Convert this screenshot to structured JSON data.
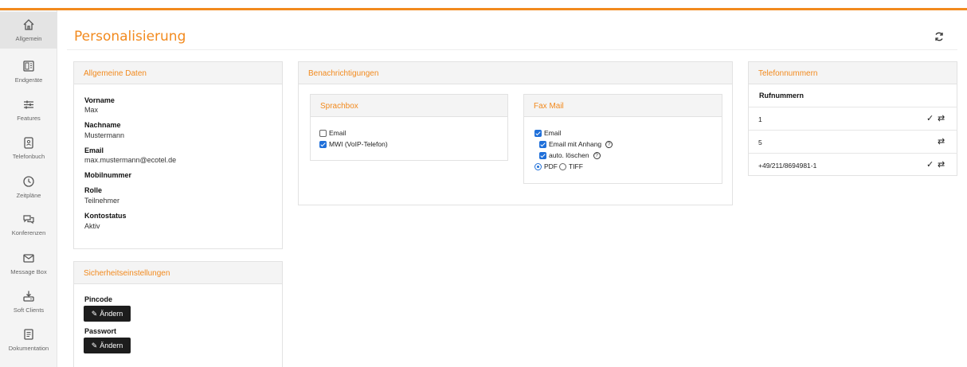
{
  "sidebar": {
    "items": [
      {
        "label": "Allgemein",
        "icon": "home-icon",
        "active": true
      },
      {
        "label": "Endgeräte",
        "icon": "device-icon"
      },
      {
        "label": "Features",
        "icon": "sliders-icon"
      },
      {
        "label": "Telefonbuch",
        "icon": "phonebook-icon"
      },
      {
        "label": "Zeitpläne",
        "icon": "clock-icon"
      },
      {
        "label": "Konferenzen",
        "icon": "chat-icon"
      },
      {
        "label": "Message Box",
        "icon": "mail-icon"
      },
      {
        "label": "Soft Clients",
        "icon": "download-icon"
      },
      {
        "label": "Dokumentation",
        "icon": "document-icon"
      }
    ]
  },
  "page": {
    "title": "Personalisierung",
    "accent_color": "#f28a1e"
  },
  "general": {
    "title": "Allgemeine Daten",
    "fields": [
      {
        "label": "Vorname",
        "value": "Max"
      },
      {
        "label": "Nachname",
        "value": "Mustermann"
      },
      {
        "label": "Email",
        "value": "max.mustermann@ecotel.de"
      },
      {
        "label": "Mobilnummer",
        "value": ""
      },
      {
        "label": "Rolle",
        "value": "Teilnehmer"
      },
      {
        "label": "Kontostatus",
        "value": "Aktiv"
      }
    ]
  },
  "security": {
    "title": "Sicherheitseinstellungen",
    "pin_label": "Pincode",
    "password_label": "Passwort",
    "change_label": "Ändern"
  },
  "notifications": {
    "title": "Benachrichtigungen",
    "voicebox": {
      "title": "Sprachbox",
      "email_label": "Email",
      "email_checked": false,
      "mwi_label": "MWI (VoIP-Telefon)",
      "mwi_checked": true
    },
    "fax": {
      "title": "Fax Mail",
      "email_label": "Email",
      "email_checked": true,
      "attachment_label": "Email mit Anhang",
      "attachment_checked": true,
      "delete_label": "auto. löschen",
      "delete_checked": true,
      "format_options": [
        "PDF",
        "TIFF"
      ],
      "format_selected": "PDF"
    }
  },
  "phones": {
    "title": "Telefonnummern",
    "header": "Rufnummern",
    "rows": [
      {
        "number": "1",
        "checked": true
      },
      {
        "number": "5",
        "checked": false
      },
      {
        "number": "+49/211/8694981-1",
        "checked": true
      }
    ]
  }
}
